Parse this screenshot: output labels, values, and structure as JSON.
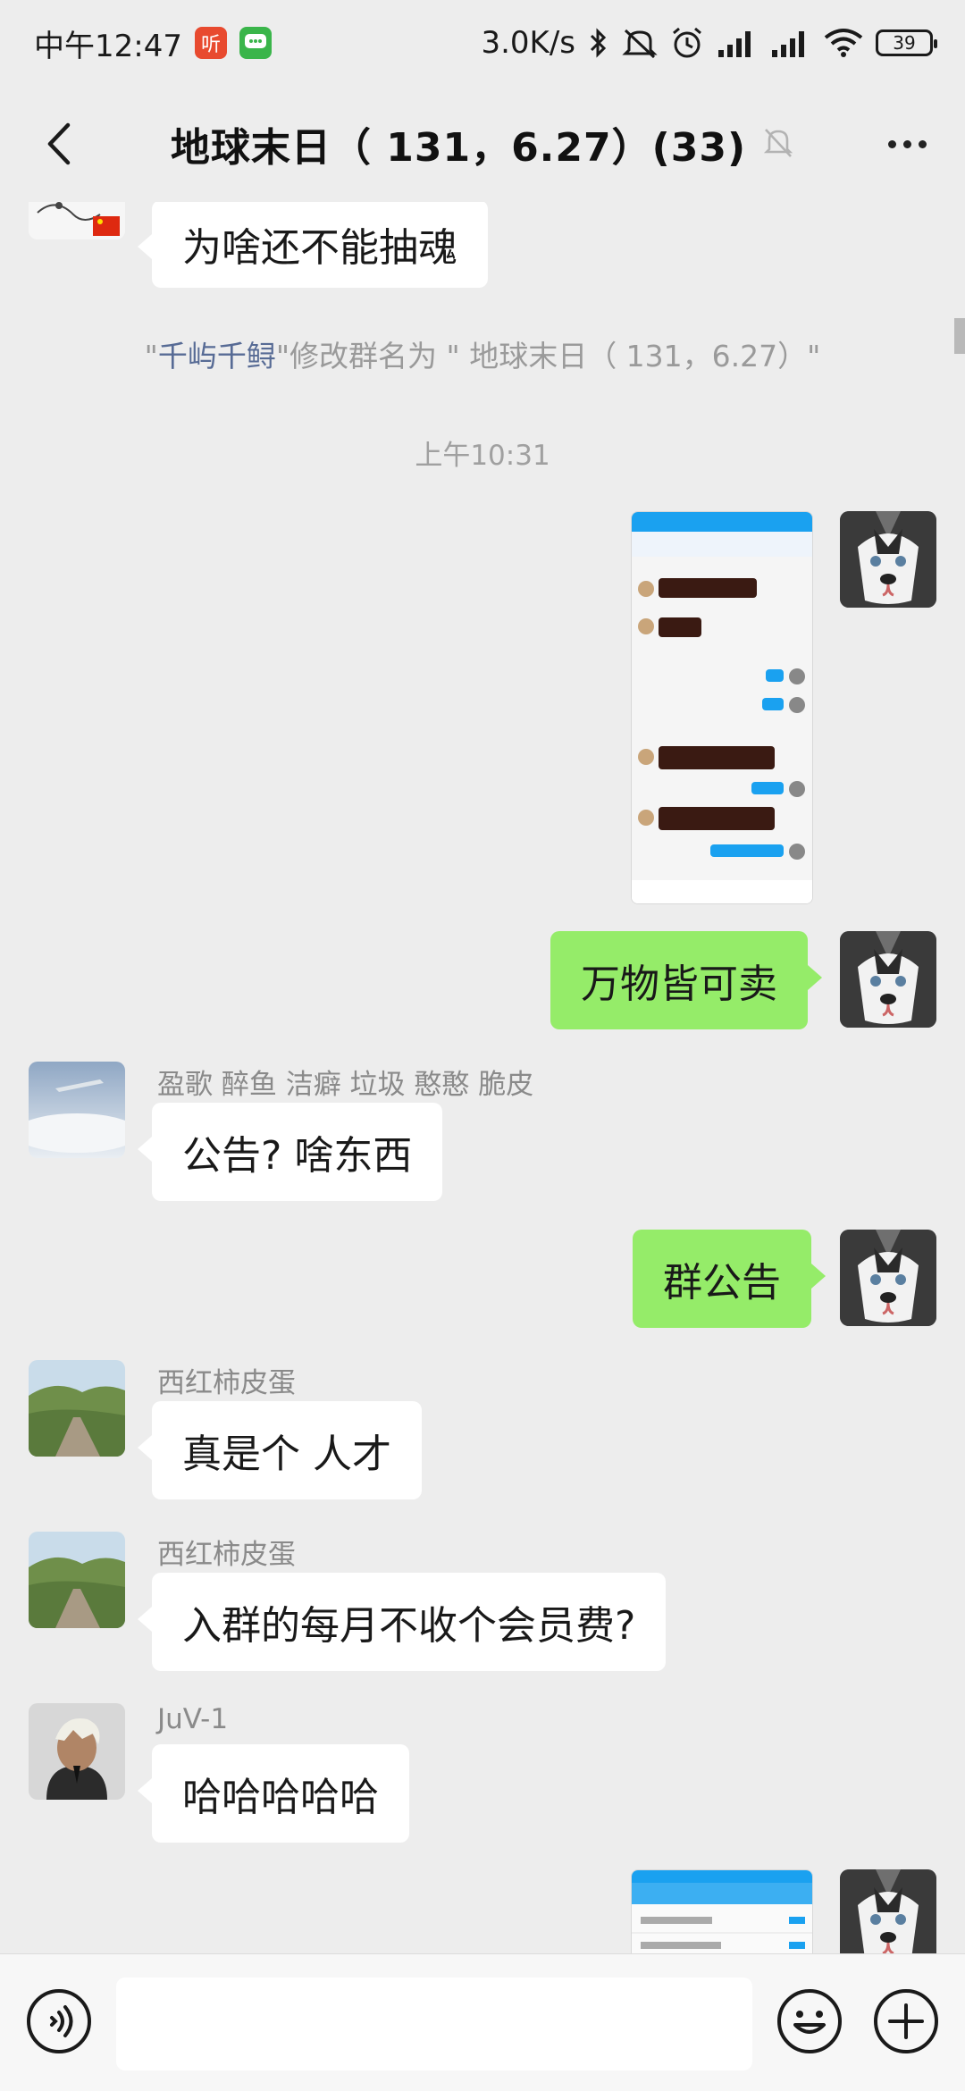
{
  "status_bar": {
    "time": "中午12:47",
    "app1_icon_label": "听",
    "network_speed": "3.0K/s",
    "battery": "39"
  },
  "header": {
    "title": "地球末日（ 131，6.27）(33)",
    "muted_icon": "bell-off-icon"
  },
  "messages": {
    "m1_text": "为啥还不能抽魂",
    "sys_prefix": "\"",
    "sys_user": "千屿千鲟",
    "sys_middle": "\"修改群名为 \" 地球末日（ 131，6.27）\"",
    "time1": "上午10:31",
    "m3_text": "万物皆可卖",
    "m4_sender": "盈歌 醉鱼 洁癖 垃圾 憨憨 脆皮",
    "m4_text": "公告? 啥东西",
    "m5_text": "群公告",
    "m6_sender": "西红柿皮蛋",
    "m6_text": "真是个 人才",
    "m7_sender": "西红柿皮蛋",
    "m7_text": "入群的每月不收个会员费?",
    "m8_sender": "JuV-1",
    "m8_text": "哈哈哈哈哈"
  },
  "input": {
    "placeholder": "",
    "voice_icon": "voice-icon",
    "emoji_icon": "emoji-icon",
    "plus_icon": "plus-icon"
  },
  "colors": {
    "background": "#ededed",
    "sent_bubble": "#95ec69",
    "received_bubble": "#ffffff",
    "link": "#576b95"
  }
}
